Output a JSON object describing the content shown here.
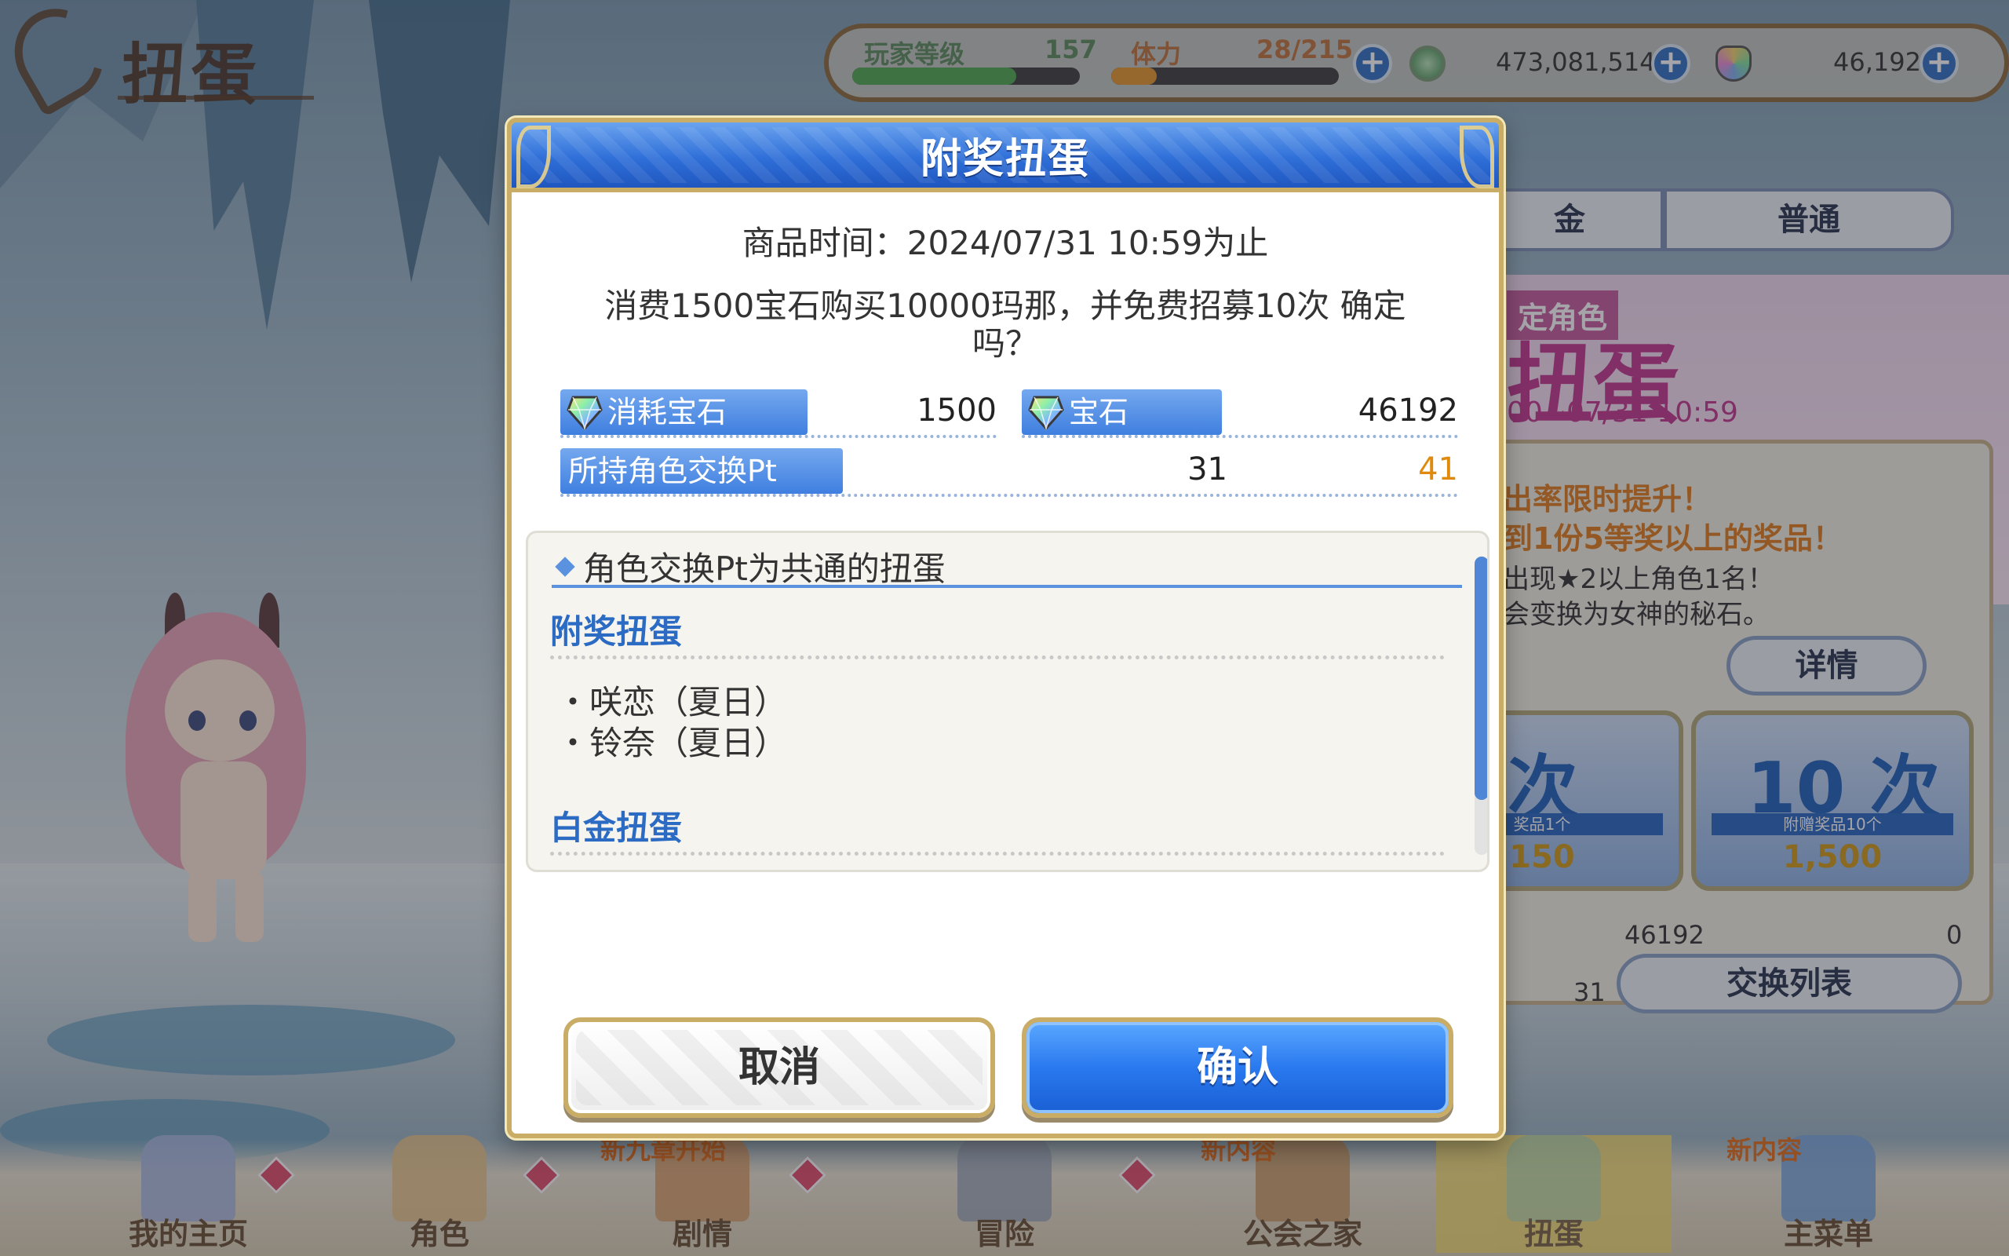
{
  "screen_title": "扭蛋",
  "status": {
    "player_level_label": "玩家等级",
    "player_level_value": "157",
    "stamina_label": "体力",
    "stamina_value": "28/215",
    "mana": "473,081,514",
    "gems": "46,192",
    "level_progress": 0.72,
    "stamina_progress": 0.2
  },
  "right_panel": {
    "tab_left": "金",
    "tab_right": "普通",
    "banner_tag": "定角色",
    "banner_title": "扭蛋",
    "banner_date": "00~07/31 10:59",
    "info_line1": "出率限时提升！",
    "info_line2": "到1份5等奖以上的奖品！",
    "info_line3": "出现★2以上角色1名！",
    "info_line4": "会变换为女神的秘石。",
    "details_button": "详情",
    "card1_big": "次",
    "card1_sub": "奖品1个",
    "card1_price": "150",
    "card2_big": "10 次",
    "card2_sub": "附赠奖品10个",
    "card2_price": "1,500",
    "gem_count": "46192",
    "pt_count": "31",
    "pt_max": "0",
    "exchange_button": "交换列表"
  },
  "nav": {
    "items": [
      {
        "label": "我的主页"
      },
      {
        "label": "角色"
      },
      {
        "label": "剧情",
        "badge": "新九章开始"
      },
      {
        "label": "冒险"
      },
      {
        "label": "公会之家",
        "badge": "新内容"
      },
      {
        "label": "扭蛋"
      },
      {
        "label": "主菜单",
        "badge": "新内容"
      }
    ]
  },
  "dialog": {
    "title": "附奖扭蛋",
    "time_line": "商品时间：2024/07/31 10:59为止",
    "question_line1": "消费1500宝石购买10000玛那，并免费招募10次 确定",
    "question_line2": "吗？",
    "cost_label": "消耗宝石",
    "cost_value": "1500",
    "gem_label": "宝石",
    "gem_value": "46192",
    "pt_label": "所持角色交换Pt",
    "pt_before": "31",
    "pt_after": "41",
    "info": {
      "heading": "角色交换Pt为共通的扭蛋",
      "section1": "附奖扭蛋",
      "items1": [
        "・咲恋（夏日）",
        "・铃奈（夏日）"
      ],
      "section2": "白金扭蛋"
    },
    "cancel_label": "取消",
    "confirm_label": "确认"
  },
  "colors": {
    "header_blue": "#2f6fd8",
    "gold_frame": "#c9ad67",
    "accent_orange": "#e08a0d",
    "section_blue": "#2b6bc4"
  }
}
